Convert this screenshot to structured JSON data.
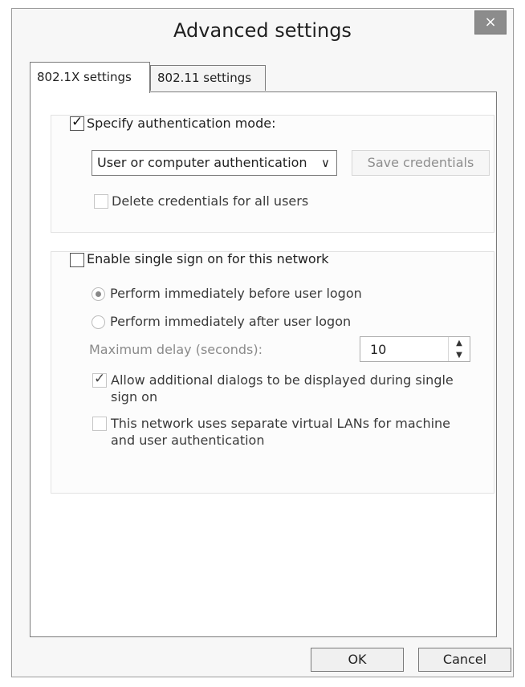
{
  "dialog": {
    "title": "Advanced settings",
    "close_glyph": "×",
    "tabs": [
      {
        "label": "802.1X settings",
        "selected": true
      },
      {
        "label": "802.11 settings",
        "selected": false
      }
    ]
  },
  "auth": {
    "specify_mode_label": "Specify authentication mode:",
    "specify_mode_checked": true,
    "mode_selected": "User or computer authentication",
    "mode_chevron": "∨",
    "save_credentials_label": "Save credentials",
    "delete_credentials_label": "Delete credentials for all users",
    "delete_credentials_checked": false
  },
  "sso": {
    "enable_label": "Enable single sign on for this network",
    "enable_checked": false,
    "radio_before_label": "Perform immediately before user logon",
    "radio_before_selected": true,
    "radio_after_label": "Perform immediately after user logon",
    "radio_after_selected": false,
    "max_delay_label": "Maximum delay (seconds):",
    "max_delay_value": "10",
    "spin_up": "▲",
    "spin_down": "▼",
    "allow_dialogs_label": "Allow additional dialogs to be displayed during single sign on",
    "allow_dialogs_checked": true,
    "separate_vlans_label": "This network uses separate virtual LANs for machine and user authentication",
    "separate_vlans_checked": false
  },
  "footer": {
    "ok_label": "OK",
    "cancel_label": "Cancel"
  }
}
